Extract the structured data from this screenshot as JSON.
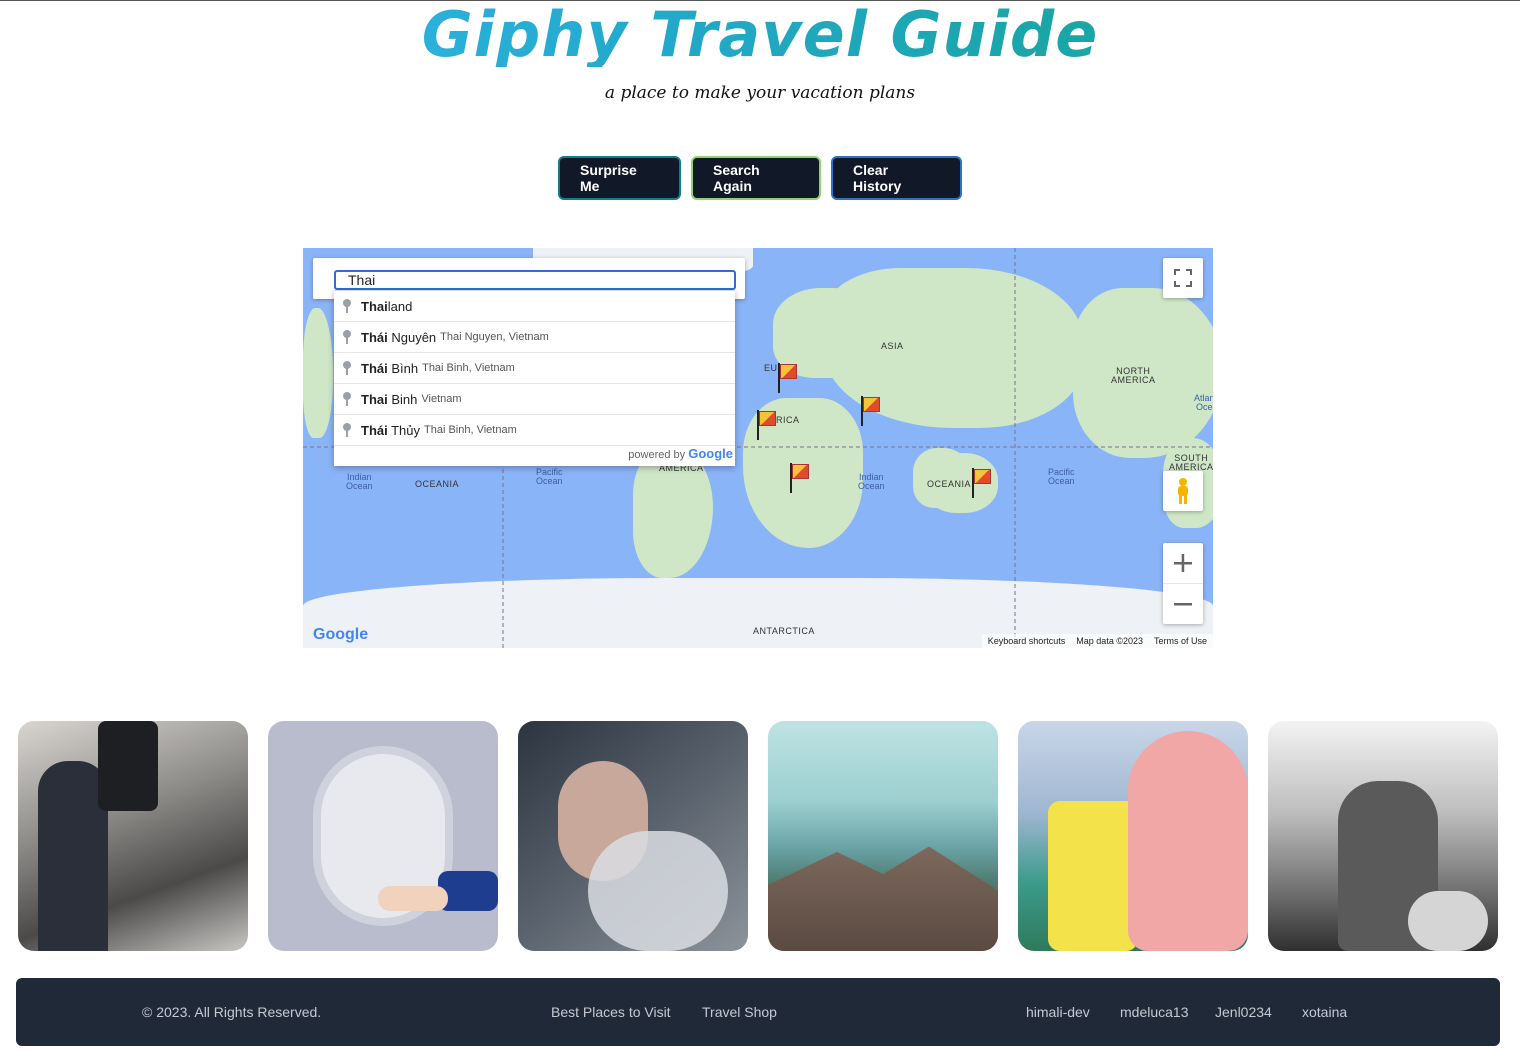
{
  "header": {
    "title": "Giphy Travel Guide",
    "subtitle": "a place to make your vacation plans"
  },
  "buttons": {
    "surprise": "Surprise Me",
    "search_again": "Search Again",
    "clear_history": "Clear History"
  },
  "map": {
    "search_value": "Thai",
    "autocomplete": [
      {
        "match": "Thai",
        "rest": "land",
        "secondary": ""
      },
      {
        "match": "Thái",
        "rest": " Nguyên",
        "secondary": "Thai Nguyen, Vietnam"
      },
      {
        "match": "Thái",
        "rest": " Bình",
        "secondary": "Thai Binh, Vietnam"
      },
      {
        "match": "Thai",
        "rest": " Binh",
        "secondary": "Vietnam"
      },
      {
        "match": "Thái",
        "rest": " Thủy",
        "secondary": "Thai Binh, Vietnam"
      }
    ],
    "powered_by": "powered by",
    "powered_brand": "Google",
    "labels": {
      "asia": "ASIA",
      "europe": "EU",
      "africa": "RICA",
      "north_america": "NORTH\nAMERICA",
      "south_america_right": "SOUTH\nAMERICA",
      "south_america_left": "AMERICA",
      "oceania_left": "OCEANIA",
      "oceania_right": "OCEANIA",
      "antarctica": "ANTARCTICA",
      "indian_ocean_left": "Indian\nOcean",
      "indian_ocean_right": "Indian\nOcean",
      "pacific_ocean_left": "Pacific\nOcean",
      "pacific_ocean_right": "Pacific\nOcean",
      "atlantic_ocean": "Atlan\nOce"
    },
    "google_logo": "Google",
    "footer": {
      "shortcuts": "Keyboard shortcuts",
      "map_data": "Map data ©2023",
      "terms": "Terms of Use"
    },
    "icons": [
      "fullscreen-icon",
      "pegman-icon",
      "zoom-in-icon",
      "zoom-out-icon",
      "flag-marker-icon"
    ]
  },
  "gifs": [
    {
      "name": "airplane-cabin-gif"
    },
    {
      "name": "airplane-window-gif"
    },
    {
      "name": "woman-smoke-gif"
    },
    {
      "name": "mountain-lake-gif"
    },
    {
      "name": "spongebob-patrick-gif"
    },
    {
      "name": "vespa-ride-gif"
    }
  ],
  "footer": {
    "copyright": "© 2023. All Rights Reserved.",
    "links": [
      "Best Places to Visit",
      "Travel Shop"
    ],
    "authors": [
      "himali-dev",
      "mdeluca13",
      "Jenl0234",
      "xotaina"
    ]
  }
}
